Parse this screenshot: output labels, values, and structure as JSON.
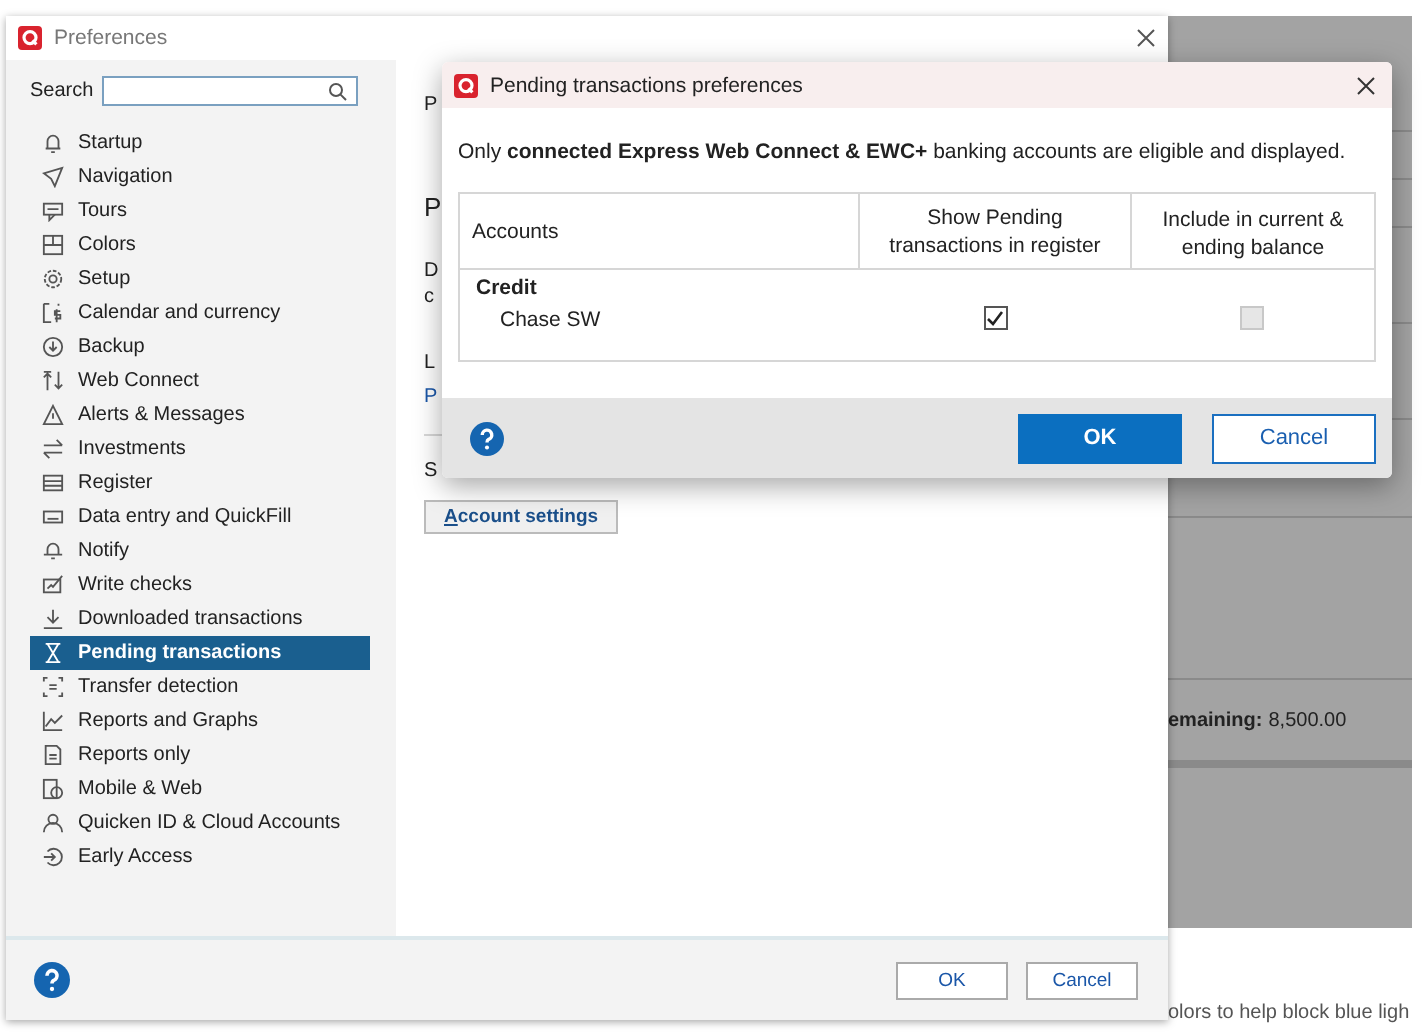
{
  "background_app": {
    "remaining_label": "emaining:",
    "remaining_value": "8,500.00",
    "footer_text": "olors to help block blue ligh"
  },
  "preferences": {
    "title": "Preferences",
    "search": {
      "label": "Search"
    },
    "sidebar": {
      "items": [
        {
          "label": "Startup",
          "selected": false
        },
        {
          "label": "Navigation",
          "selected": false
        },
        {
          "label": "Tours",
          "selected": false
        },
        {
          "label": "Colors",
          "selected": false
        },
        {
          "label": "Setup",
          "selected": false
        },
        {
          "label": "Calendar and currency",
          "selected": false
        },
        {
          "label": "Backup",
          "selected": false
        },
        {
          "label": "Web Connect",
          "selected": false
        },
        {
          "label": "Alerts & Messages",
          "selected": false
        },
        {
          "label": "Investments",
          "selected": false
        },
        {
          "label": "Register",
          "selected": false
        },
        {
          "label": "Data entry and QuickFill",
          "selected": false
        },
        {
          "label": "Notify",
          "selected": false
        },
        {
          "label": "Write checks",
          "selected": false
        },
        {
          "label": "Downloaded transactions",
          "selected": false
        },
        {
          "label": "Pending transactions",
          "selected": true
        },
        {
          "label": "Transfer detection",
          "selected": false
        },
        {
          "label": "Reports and Graphs",
          "selected": false
        },
        {
          "label": "Reports only",
          "selected": false
        },
        {
          "label": "Mobile & Web",
          "selected": false
        },
        {
          "label": "Quicken ID & Cloud Accounts",
          "selected": false
        },
        {
          "label": "Early Access",
          "selected": false
        }
      ]
    },
    "content_fragments": [
      {
        "kind": "text",
        "text": "P"
      },
      {
        "kind": "heading",
        "text": "P"
      },
      {
        "kind": "text",
        "text": "D"
      },
      {
        "kind": "text",
        "text": "c"
      },
      {
        "kind": "text",
        "text": "L"
      },
      {
        "kind": "link",
        "text": "P"
      },
      {
        "kind": "divider"
      },
      {
        "kind": "text",
        "text": "S"
      }
    ],
    "account_settings_button": "Account settings",
    "buttons": [
      "OK",
      "Cancel"
    ]
  },
  "dialog": {
    "title": "Pending transactions preferences",
    "message": "Only **connected Express Web Connect & EWC+** banking accounts are eligible and displayed.",
    "table": {
      "columns": [
        "Accounts",
        "Show Pending transactions in register",
        "Include in current & ending balance"
      ],
      "groups": [
        {
          "name": "Credit",
          "rows": [
            {
              "account": "Chase SW",
              "show_pending": {
                "checked": true,
                "disabled": false
              },
              "include_balance": {
                "checked": false,
                "disabled": true
              }
            }
          ]
        }
      ]
    },
    "buttons": [
      {
        "label": "OK",
        "kind": "primary"
      },
      {
        "label": "Cancel",
        "kind": "secondary"
      }
    ]
  }
}
